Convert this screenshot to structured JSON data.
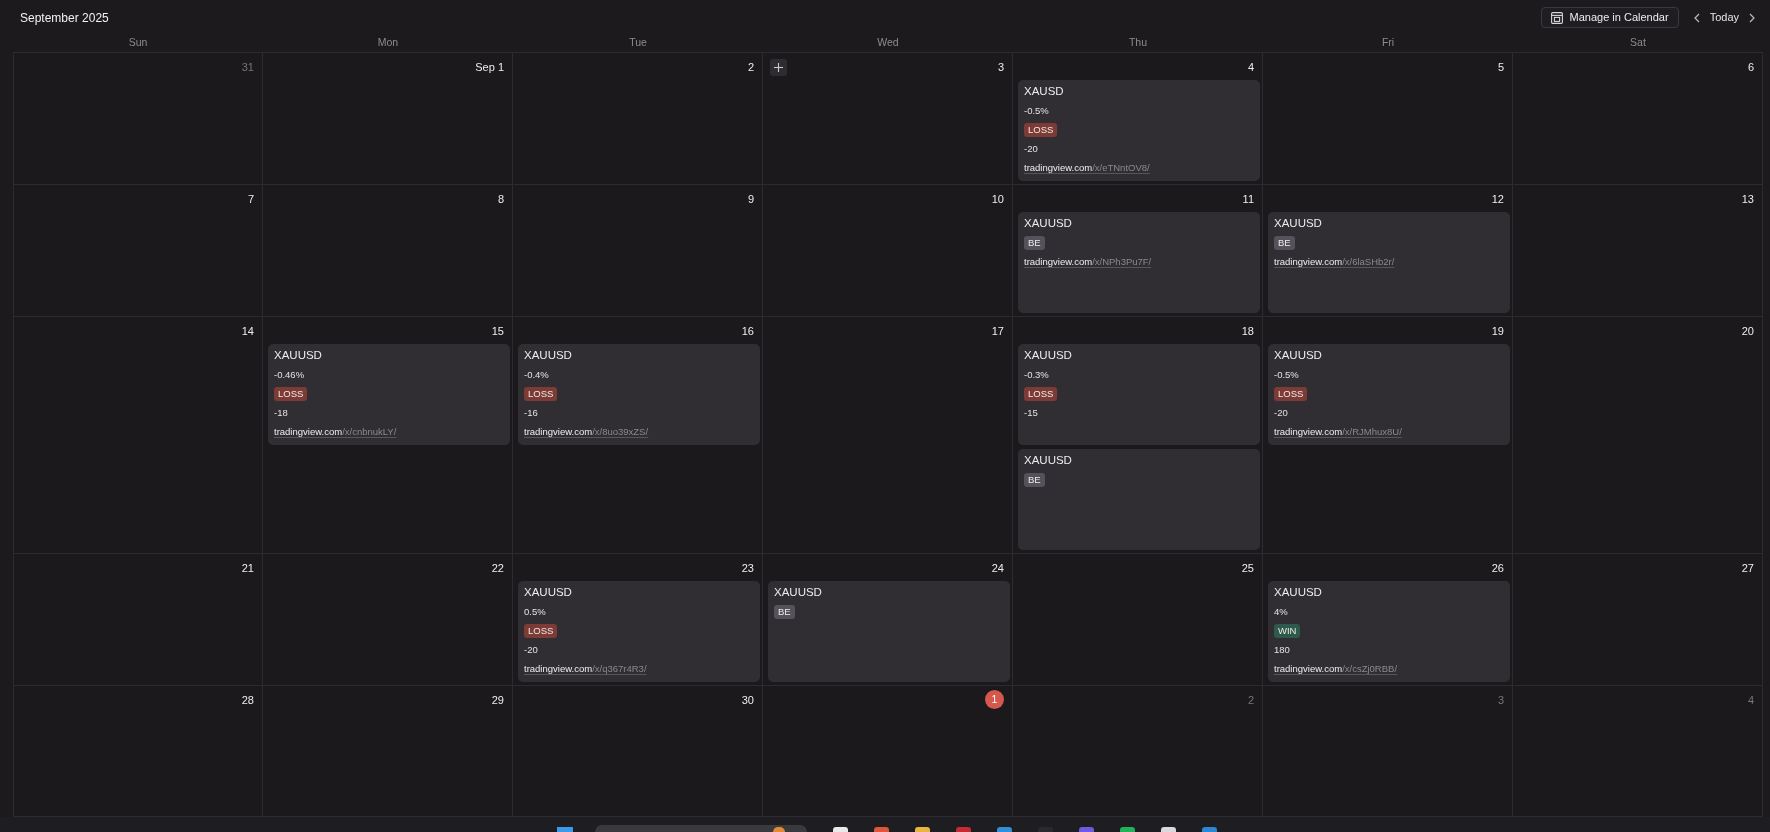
{
  "header": {
    "title": "September 2025",
    "manage_button": "Manage in Calendar",
    "today_button": "Today"
  },
  "weekdays": [
    "Sun",
    "Mon",
    "Tue",
    "Wed",
    "Thu",
    "Fri",
    "Sat"
  ],
  "weeks": [
    {
      "days": [
        {
          "label": "31",
          "in_month": false,
          "today": false,
          "add_button": false
        },
        {
          "label": "Sep 1",
          "in_month": true,
          "today": false,
          "add_button": false
        },
        {
          "label": "2",
          "in_month": true,
          "today": false,
          "add_button": false
        },
        {
          "label": "3",
          "in_month": true,
          "today": false,
          "add_button": true
        },
        {
          "label": "4",
          "in_month": true,
          "today": false,
          "add_button": false,
          "events": [
            {
              "title": "XAUSD",
              "percent": "-0.5%",
              "result": {
                "label": "LOSS",
                "color": "#7d3b36"
              },
              "points": "-20",
              "link": {
                "domain": "tradingview.com",
                "path": "/x/eTNntOV8/"
              }
            }
          ]
        },
        {
          "label": "5",
          "in_month": true,
          "today": false,
          "add_button": false
        },
        {
          "label": "6",
          "in_month": true,
          "today": false,
          "add_button": false
        }
      ]
    },
    {
      "days": [
        {
          "label": "7",
          "in_month": true,
          "today": false,
          "add_button": false
        },
        {
          "label": "8",
          "in_month": true,
          "today": false,
          "add_button": false
        },
        {
          "label": "9",
          "in_month": true,
          "today": false,
          "add_button": false
        },
        {
          "label": "10",
          "in_month": true,
          "today": false,
          "add_button": false
        },
        {
          "label": "11",
          "in_month": true,
          "today": false,
          "add_button": false,
          "events": [
            {
              "title": "XAUUSD",
              "result": {
                "label": "BE",
                "color": "#54525a"
              },
              "link": {
                "domain": "tradingview.com",
                "path": "/x/NPh3Pu7F/"
              }
            }
          ]
        },
        {
          "label": "12",
          "in_month": true,
          "today": false,
          "add_button": false,
          "events": [
            {
              "title": "XAUUSD",
              "result": {
                "label": "BE",
                "color": "#54525a"
              },
              "link": {
                "domain": "tradingview.com",
                "path": "/x/6laSHb2r/"
              }
            }
          ]
        },
        {
          "label": "13",
          "in_month": true,
          "today": false,
          "add_button": false
        }
      ]
    },
    {
      "days": [
        {
          "label": "14",
          "in_month": true,
          "today": false,
          "add_button": false
        },
        {
          "label": "15",
          "in_month": true,
          "today": false,
          "add_button": false,
          "events": [
            {
              "title": "XAUUSD",
              "percent": "-0.46%",
              "result": {
                "label": "LOSS",
                "color": "#7d3b36"
              },
              "points": "-18",
              "link": {
                "domain": "tradingview.com",
                "path": "/x/cnbnukLY/"
              }
            }
          ]
        },
        {
          "label": "16",
          "in_month": true,
          "today": false,
          "add_button": false,
          "events": [
            {
              "title": "XAUUSD",
              "percent": "-0.4%",
              "result": {
                "label": "LOSS",
                "color": "#7d3b36"
              },
              "points": "-16",
              "link": {
                "domain": "tradingview.com",
                "path": "/x/8uo39xZS/"
              }
            }
          ]
        },
        {
          "label": "17",
          "in_month": true,
          "today": false,
          "add_button": false
        },
        {
          "label": "18",
          "in_month": true,
          "today": false,
          "add_button": false,
          "events": [
            {
              "title": "XAUUSD",
              "percent": "-0.3%",
              "result": {
                "label": "LOSS",
                "color": "#7d3b36"
              },
              "points": "-15"
            },
            {
              "title": "XAUUSD",
              "result": {
                "label": "BE",
                "color": "#54525a"
              }
            }
          ]
        },
        {
          "label": "19",
          "in_month": true,
          "today": false,
          "add_button": false,
          "events": [
            {
              "title": "XAUUSD",
              "percent": "-0.5%",
              "result": {
                "label": "LOSS",
                "color": "#7d3b36"
              },
              "points": "-20",
              "link": {
                "domain": "tradingview.com",
                "path": "/x/RJMhux8U/"
              }
            }
          ]
        },
        {
          "label": "20",
          "in_month": true,
          "today": false,
          "add_button": false
        }
      ]
    },
    {
      "days": [
        {
          "label": "21",
          "in_month": true,
          "today": false,
          "add_button": false
        },
        {
          "label": "22",
          "in_month": true,
          "today": false,
          "add_button": false
        },
        {
          "label": "23",
          "in_month": true,
          "today": false,
          "add_button": false,
          "events": [
            {
              "title": "XAUUSD",
              "percent": "0.5%",
              "result": {
                "label": "LOSS",
                "color": "#7d3b36"
              },
              "points": "-20",
              "link": {
                "domain": "tradingview.com",
                "path": "/x/q367r4R3/"
              }
            }
          ]
        },
        {
          "label": "24",
          "in_month": true,
          "today": false,
          "add_button": false,
          "events": [
            {
              "title": "XAUUSD",
              "result": {
                "label": "BE",
                "color": "#54525a"
              }
            }
          ]
        },
        {
          "label": "25",
          "in_month": true,
          "today": false,
          "add_button": false
        },
        {
          "label": "26",
          "in_month": true,
          "today": false,
          "add_button": false,
          "events": [
            {
              "title": "XAUUSD",
              "percent": "4%",
              "result": {
                "label": "WIN",
                "color": "#2d5a4a"
              },
              "points": "180",
              "link": {
                "domain": "tradingview.com",
                "path": "/x/csZj0RBB/"
              }
            }
          ]
        },
        {
          "label": "27",
          "in_month": true,
          "today": false,
          "add_button": false
        }
      ]
    },
    {
      "days": [
        {
          "label": "28",
          "in_month": true,
          "today": false,
          "add_button": false
        },
        {
          "label": "29",
          "in_month": true,
          "today": false,
          "add_button": false
        },
        {
          "label": "30",
          "in_month": true,
          "today": false,
          "add_button": false
        },
        {
          "label": "1",
          "today": true,
          "add_button": false
        },
        {
          "label": "2",
          "in_month": false,
          "today": false,
          "add_button": false
        },
        {
          "label": "3",
          "in_month": false,
          "today": false,
          "add_button": false
        },
        {
          "label": "4",
          "in_month": false,
          "today": false,
          "add_button": false
        }
      ]
    }
  ]
}
